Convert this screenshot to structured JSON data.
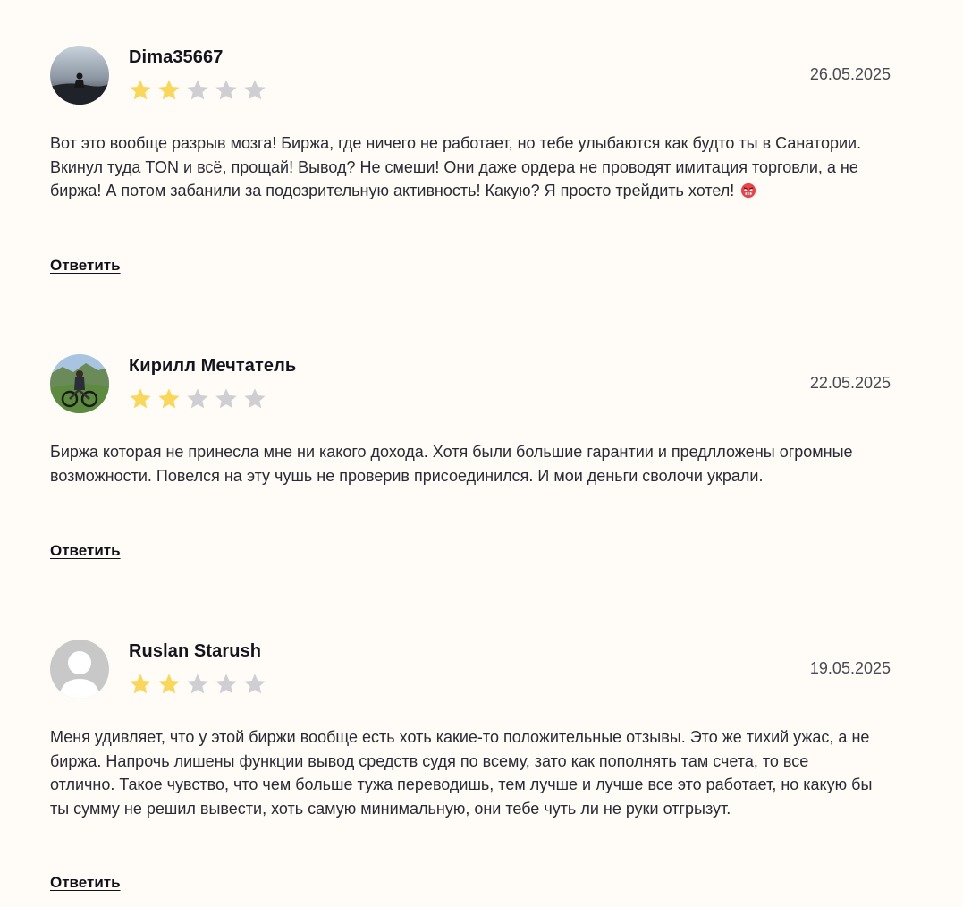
{
  "reviews": [
    {
      "author": "Dima35667",
      "date": "26.05.2025",
      "rating": 2,
      "rating_max": 5,
      "text": "Вот это вообще разрыв мозга! Биржа, где ничего не работает, но тебе улыбаются как будто ты в Санатории. Вкинул туда TON и всё, прощай! Вывод? Не смеши! Они даже ордера не проводят имитация торговли, а не биржа! А потом забанили за подозрительную активность! Какую? Я просто трейдить хотел!",
      "emoji": "angry-face-emoji",
      "reply_label": "Ответить"
    },
    {
      "author": "Кирилл Мечтатель",
      "date": "22.05.2025",
      "rating": 2,
      "rating_max": 5,
      "text": "Биржа которая не принесла мне ни какого дохода. Хотя были большие гарантии и предлложены огромные возможности. Повелся на эту чушь не проверив присоединился. И мои деньги сволочи украли.",
      "reply_label": "Ответить"
    },
    {
      "author": "Ruslan Starush",
      "date": "19.05.2025",
      "rating": 2,
      "rating_max": 5,
      "text": "Меня удивляет, что у этой биржи вообще есть хоть какие-то положительные отзывы. Это же тихий ужас, а не биржа. Напрочь лишены функции вывод средств судя по всему, зато как пополнять там счета, то все отлично. Такое чувство, что чем больше тужа переводишь, тем лучше и лучше все это работает, но какую бы ты сумму не решил вывести, хоть самую минимальную, они тебе чуть ли не руки отгрызут.",
      "reply_label": "Ответить"
    }
  ],
  "colors": {
    "background": "#fffbf7",
    "star_filled": "#f9d65c",
    "star_empty": "#cfcfd3",
    "text": "#2a2a32"
  }
}
